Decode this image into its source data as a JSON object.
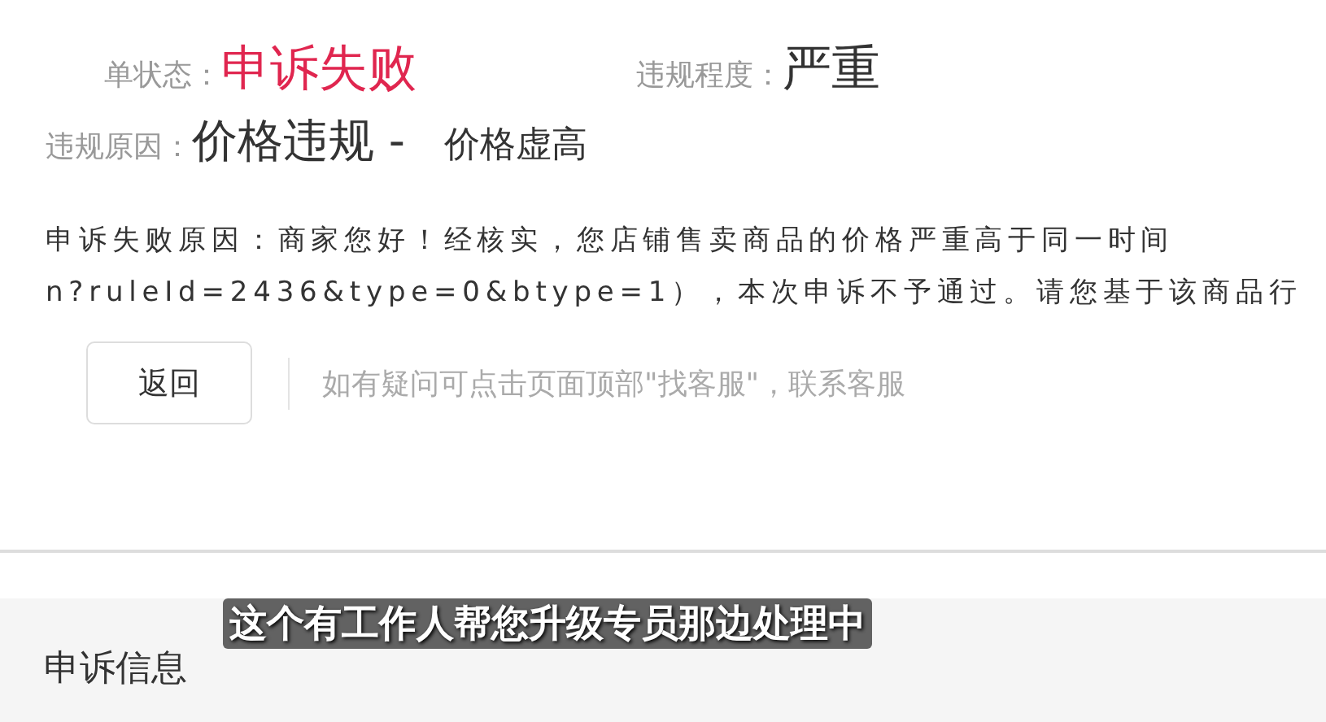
{
  "status": {
    "label": "单状态：",
    "value": "申诉失败"
  },
  "severity": {
    "label": "违规程度：",
    "value": "严重"
  },
  "reason": {
    "label": "违规原因：",
    "category": "价格违规 -",
    "detail": "价格虚高"
  },
  "failure_reason_lines": [
    "申诉失败原因：商家您好！经核实，您店铺售卖商品的价格严重高于同一时间",
    "n?ruleId=2436&type=0&btype=1），本次申诉不予通过。请您基于该商品行"
  ],
  "back_button": "返回",
  "hint": "如有疑问可点击页面顶部\"找客服\"，联系客服",
  "section_title": "申诉信息",
  "caption": "这个有工作人帮您升级专员那边处理中"
}
